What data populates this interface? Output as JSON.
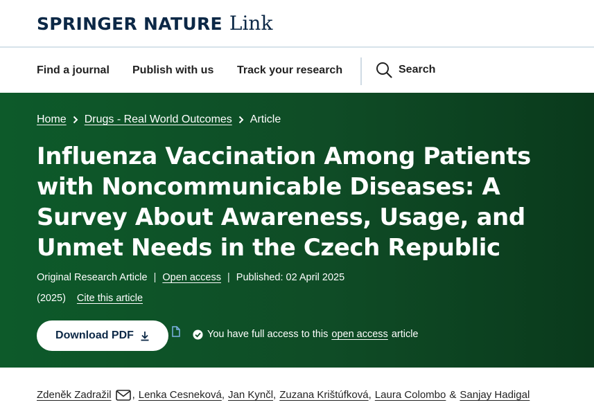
{
  "header": {
    "brand": "SPRINGER NATURE",
    "product": "Link"
  },
  "nav": {
    "items": [
      "Find a journal",
      "Publish with us",
      "Track your research"
    ],
    "search_label": "Search"
  },
  "breadcrumb": {
    "home": "Home",
    "journal": "Drugs - Real World Outcomes",
    "current": "Article"
  },
  "article": {
    "title": "Influenza Vaccination Among Patients with Noncommunicable Diseases: A Survey About Awareness, Usage, and Unmet Needs in the Czech Republic",
    "type": "Original Research Article",
    "open_access": "Open access",
    "published": "Published: 02 April 2025",
    "year": "(2025)",
    "cite": "Cite this article"
  },
  "actions": {
    "download_label": "Download PDF",
    "access_prefix": "You have full access to this",
    "access_link": "open access",
    "access_suffix": "article"
  },
  "authors": {
    "list": [
      "Zdeněk Zadražil",
      "Lenka Cesneková",
      "Jan Kynčl",
      "Zuzana Krištúfková",
      "Laura Colombo",
      "Sanjay Hadigal"
    ],
    "amp": "&"
  },
  "colors": {
    "brand_navy": "#0c2846",
    "hero_green": "#0d5a2a",
    "divider": "#d6e2ea"
  },
  "icons": [
    "search-icon",
    "chevron-right-icon",
    "download-icon",
    "file-icon",
    "check-circle-icon",
    "mail-icon"
  ]
}
